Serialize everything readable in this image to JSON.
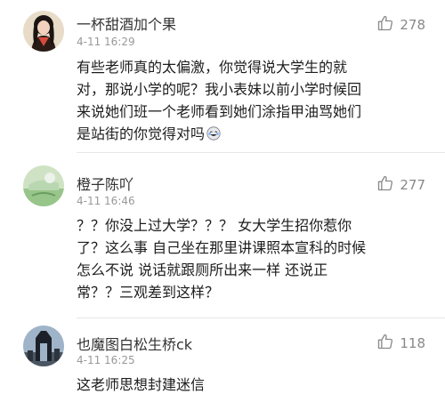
{
  "comments": [
    {
      "username": "一杯甜酒加个果",
      "time": "4-11 16:29",
      "likes": "278",
      "avatar_icon": "user-avatar-girl",
      "lines": [
        "有些老师真的太偏激，你觉得说大学生的就",
        "对，那说小学的呢？我小表妹以前小学时候回",
        "来说她们班一个老师看到她们涂指甲油骂她们",
        "是站街的你觉得对吗"
      ],
      "emoji_icon": "laughing-crying-emoji-icon"
    },
    {
      "username": "橙子陈吖",
      "time": "4-11 16:46",
      "likes": "277",
      "avatar_icon": "user-avatar-green",
      "lines": [
        "？？你没上过大学？？？ 女大学生招你惹你",
        "了？这么事   自己坐在那里讲课照本宣科的时候",
        "怎么不说     说话就跟厕所出来一样  还说正",
        "常？？三观差到这样？"
      ]
    },
    {
      "username": "也魔图白松生桥ck",
      "time": "4-11 16:25",
      "likes": "118",
      "avatar_icon": "user-avatar-building",
      "lines": [
        "这老师思想封建迷信"
      ]
    }
  ],
  "colors": {
    "text": "#1d1d1d",
    "meta": "#999999",
    "divider": "#e6e6e6"
  }
}
